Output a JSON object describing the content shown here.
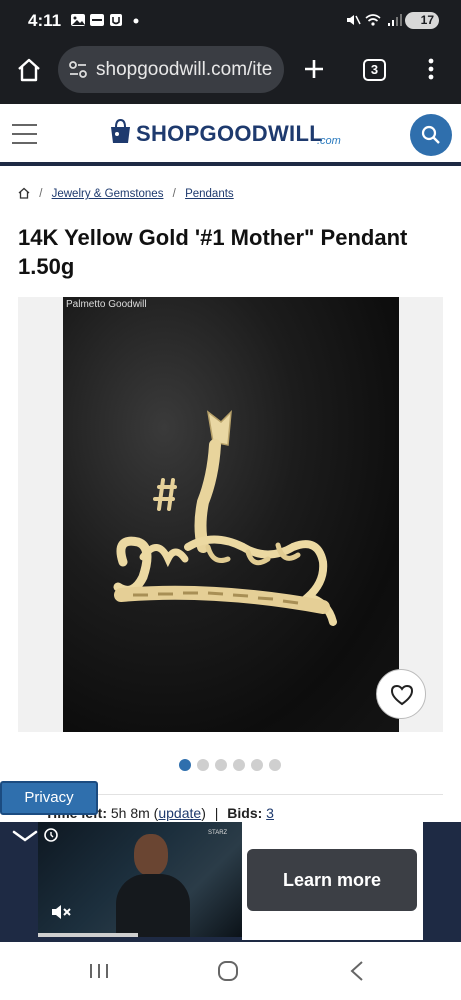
{
  "status_bar": {
    "time": "4:11",
    "battery": "17"
  },
  "browser": {
    "url": "shopgoodwill.com/ite",
    "tab_count": "3"
  },
  "site": {
    "logo": "SHOPGOODWILL",
    "logo_suffix": ".com",
    "accent_color": "#2f6fad",
    "brand_color": "#1e3a6e"
  },
  "breadcrumb": {
    "items": [
      "Jewelry & Gemstones",
      "Pendants"
    ],
    "separator": "/"
  },
  "item": {
    "title": "14K Yellow Gold '#1 Mother\" Pendant 1.50g",
    "photo_caption": "Palmetto Goodwill",
    "pendant_text": "#1 Mother"
  },
  "carousel": {
    "total": 6,
    "active_index": 0
  },
  "auction": {
    "time_left_label": "Time left:",
    "time_left_value": "5h 8m",
    "update_link": "update",
    "bids_label": "Bids:",
    "bids_value": "3"
  },
  "privacy": {
    "label": "Privacy"
  },
  "ad": {
    "cta": "Learn more",
    "video_brand": "STARZ"
  },
  "icons": {
    "home": "home-icon",
    "menu": "hamburger-menu-icon",
    "search": "search-icon",
    "favorite": "heart-icon",
    "mute": "mute-icon"
  }
}
